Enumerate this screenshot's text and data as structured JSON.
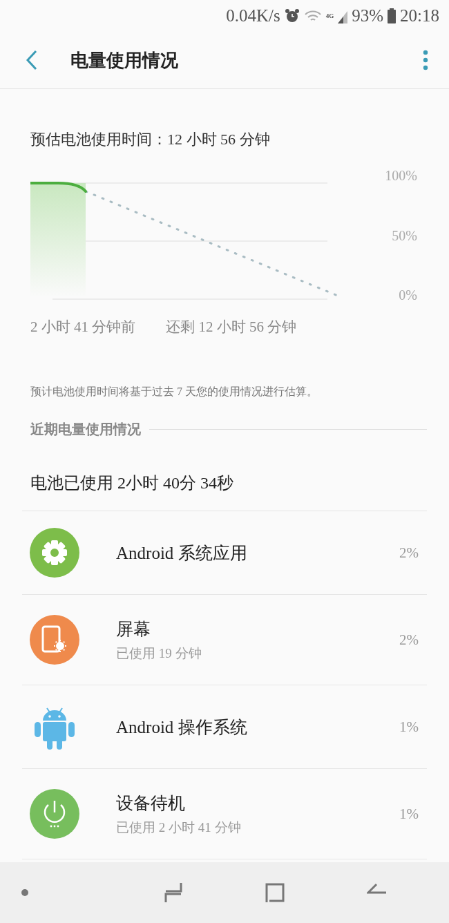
{
  "status_bar": {
    "speed": "0.04K/s",
    "network": "4G",
    "battery": "93%",
    "time": "20:18"
  },
  "app_bar": {
    "title": "电量使用情况"
  },
  "estimate": "预估电池使用时间：12 小时 56 分钟",
  "chart": {
    "y_labels": [
      "100%",
      "50%",
      "0%"
    ],
    "start_label": "2 小时 41 分钟前",
    "end_label": "还剩 12 小时 56 分钟"
  },
  "note": "预计电池使用时间将基于过去 7 天您的使用情况进行估算。",
  "section_title": "近期电量使用情况",
  "used_total": "电池已使用 2小时 40分 34秒",
  "items": [
    {
      "kind": "gear",
      "name": "Android 系统应用",
      "percent": "2%"
    },
    {
      "kind": "screen",
      "name": "屏幕",
      "detail": "已使用 19 分钟",
      "percent": "2%"
    },
    {
      "kind": "android",
      "name": "Android 操作系统",
      "percent": "1%"
    },
    {
      "kind": "power",
      "name": "设备待机",
      "detail": "已使用 2 小时 41 分钟",
      "percent": "1%"
    }
  ]
}
